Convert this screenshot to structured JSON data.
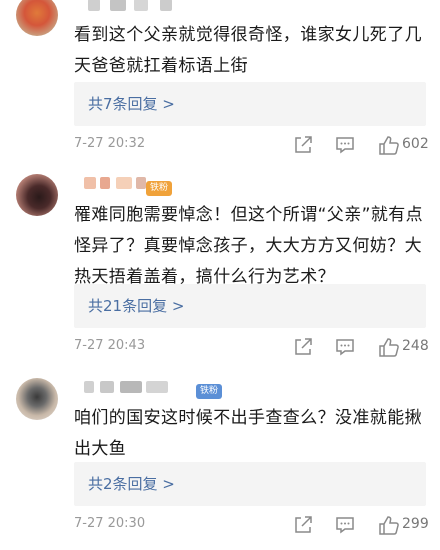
{
  "comments": [
    {
      "text": "看到这个父亲就觉得很奇怪，谁家女儿死了几天爸爸就扛着标语上街",
      "replies_label": "共7条回复 >",
      "time": "7-27 20:32",
      "likes": "602"
    },
    {
      "badge": "铁粉",
      "text": "罹难同胞需要悼念！但这个所谓“父亲”就有点怪异了？真要悼念孩子，大大方方又何妨？大热天捂着盖着，搞什么行为艺术？",
      "replies_label": "共21条回复 >",
      "time": "7-27 20:43",
      "likes": "248"
    },
    {
      "badge": "铁粉",
      "text": "咱们的国安这时候不出手查查么？没准就能揪出大鱼",
      "replies_label": "共2条回复 >",
      "time": "7-27 20:30",
      "likes": "299"
    }
  ],
  "icons": [
    "share-icon",
    "comment-icon",
    "like-icon"
  ],
  "colors": {
    "link": "#4a6ea2",
    "badge": "#f0a23a",
    "badge_blue": "#5b8fd6"
  }
}
